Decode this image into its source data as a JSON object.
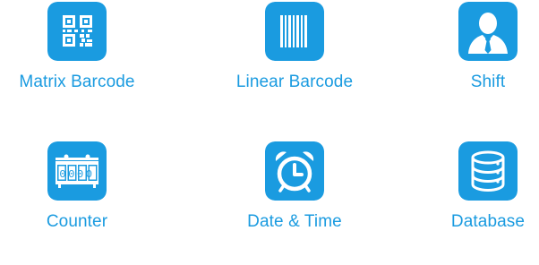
{
  "colors": {
    "tile_blue": "#1a9be0",
    "label_blue": "#1a9be0",
    "icon_white": "#ffffff"
  },
  "tiles": [
    {
      "label": "Matrix Barcode",
      "icon": "qr-code-icon"
    },
    {
      "label": "Linear Barcode",
      "icon": "barcode-icon"
    },
    {
      "label": "Shift",
      "icon": "person-tie-icon"
    },
    {
      "label": "Counter",
      "icon": "counter-icon",
      "digits": "0000"
    },
    {
      "label": "Date & Time",
      "icon": "alarm-clock-icon"
    },
    {
      "label": "Database",
      "icon": "database-icon"
    }
  ]
}
